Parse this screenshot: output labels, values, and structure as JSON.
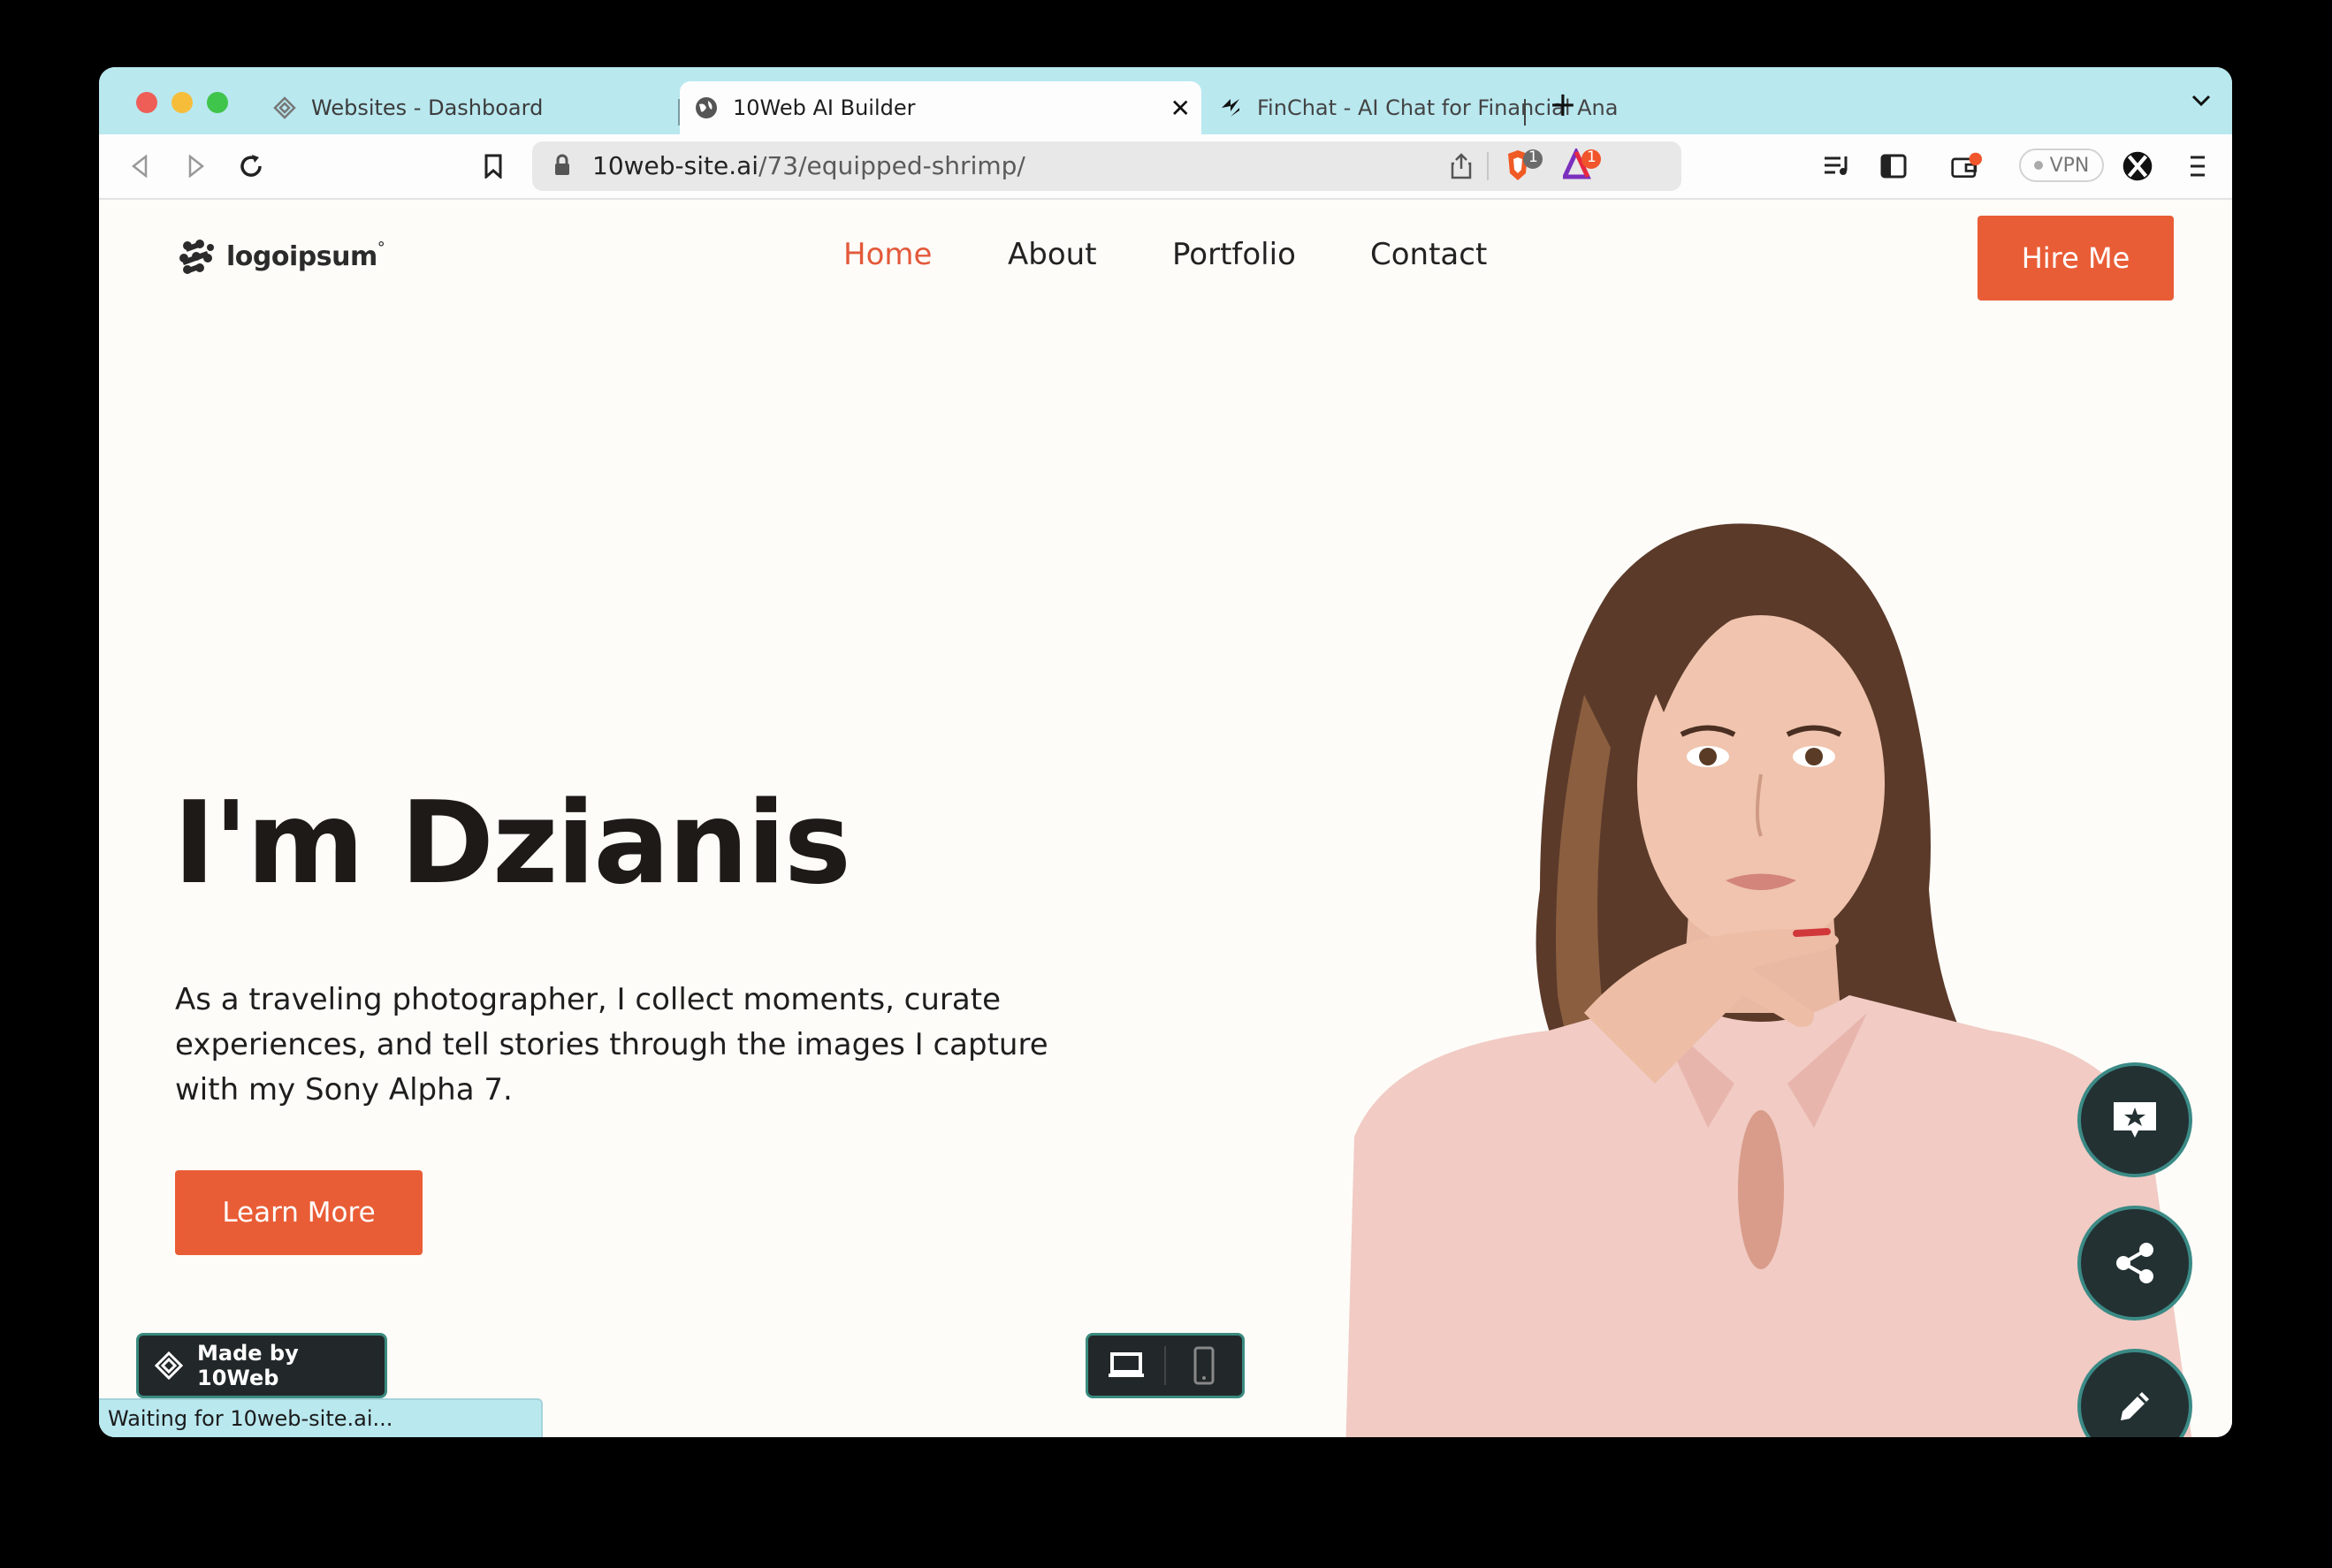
{
  "browser": {
    "tabs": [
      {
        "title": "Websites - Dashboard",
        "active": false
      },
      {
        "title": "10Web AI Builder",
        "active": true
      },
      {
        "title": "FinChat - AI Chat for Financial Analy",
        "active": false
      }
    ],
    "url": {
      "domain": "10web-site.ai",
      "path": "/73/equipped-shrimp/"
    },
    "badges": {
      "brave_shields": "1",
      "rewards": "1"
    },
    "vpn_label": "VPN"
  },
  "site": {
    "logo_text": "logoipsum",
    "logo_mark": "°",
    "nav": [
      "Home",
      "About",
      "Portfolio",
      "Contact"
    ],
    "hire_button": "Hire Me",
    "hero": {
      "title": "I'm Dzianis",
      "description": "As a traveling photographer, I collect moments, curate experiences, and tell stories through the images I capture with my Sony Alpha 7.",
      "cta": "Learn More"
    },
    "made_by": "Made by 10Web",
    "accent_color": "#e95d36"
  },
  "status_bar": "Waiting for 10web-site.ai..."
}
